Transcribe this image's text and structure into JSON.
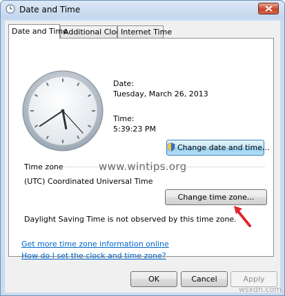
{
  "window": {
    "title": "Date and Time"
  },
  "tabs": [
    {
      "label": "Date and Time",
      "active": true
    },
    {
      "label": "Additional Clocks",
      "active": false
    },
    {
      "label": "Internet Time",
      "active": false
    }
  ],
  "clock": {
    "hour": 5,
    "minute": 39,
    "second": 23
  },
  "date": {
    "label": "Date:",
    "value": "Tuesday, March 26, 2013"
  },
  "time": {
    "label": "Time:",
    "value": "5:39:23 PM"
  },
  "buttons": {
    "change_date_time": "Change date and time...",
    "change_time_zone": "Change time zone...",
    "ok": "OK",
    "cancel": "Cancel",
    "apply": "Apply"
  },
  "timezone": {
    "section_label": "Time zone",
    "value": "(UTC) Coordinated Universal Time",
    "dst_note": "Daylight Saving Time is not observed by this time zone."
  },
  "watermark": "www.wintips.org",
  "links": [
    "Get more time zone information online",
    "How do I set the clock and time zone?"
  ],
  "site_brand": "wsxdn.com",
  "colors": {
    "link": "#0066cc",
    "arrow": "#e0262e",
    "focus": "#3c7fb1"
  }
}
